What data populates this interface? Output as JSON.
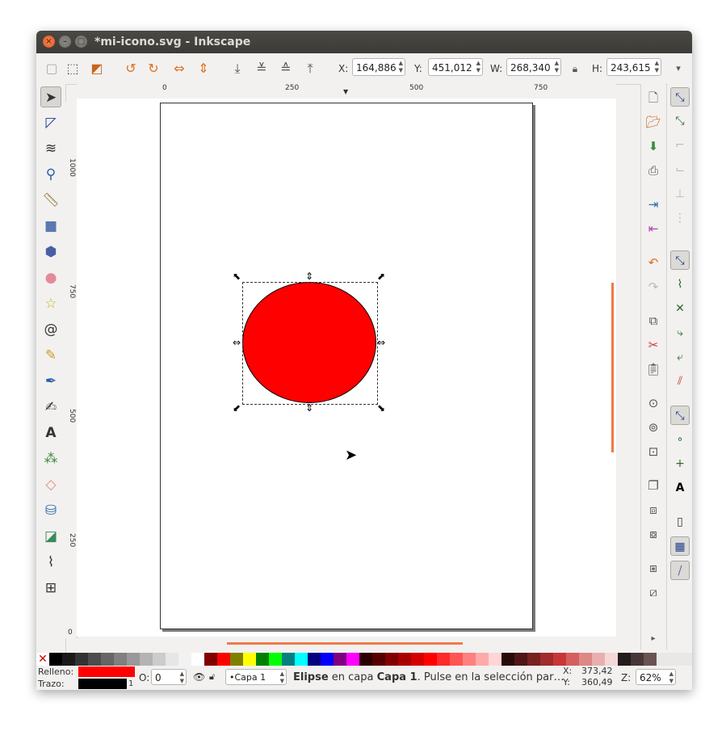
{
  "window": {
    "title": "*mi-icono.svg - Inkscape"
  },
  "toolbar": {
    "x_label": "X:",
    "x_value": "164,886",
    "y_label": "Y:",
    "y_value": "451,012",
    "w_label": "W:",
    "w_value": "268,340",
    "h_label": "H:",
    "h_value": "243,615"
  },
  "ruler": {
    "h_ticks": [
      "0",
      "250",
      "500",
      "750"
    ],
    "v_ticks": [
      "1000",
      "750",
      "500",
      "250",
      "0"
    ]
  },
  "tools": [
    "selector-tool",
    "node-tool",
    "tweak-tool",
    "zoom-tool",
    "measure-tool",
    "rectangle-tool",
    "3dbox-tool",
    "ellipse-tool",
    "star-tool",
    "spiral-tool",
    "pencil-tool",
    "pen-tool",
    "calligraphy-tool",
    "text-tool",
    "spray-tool",
    "eraser-tool",
    "bucket-tool",
    "gradient-tool",
    "dropper-tool",
    "connector-tool"
  ],
  "status": {
    "fill_label": "Relleno:",
    "stroke_label": "Trazo:",
    "stroke_width": "1",
    "opacity_label": "O:",
    "opacity_value": "0",
    "layer": "•Capa 1",
    "message_bold": "Elipse",
    "message_mid": " en capa ",
    "message_layer": "Capa 1",
    "message_rest": ". Pulse en la selección par…",
    "x_coord_label": "X:",
    "x_coord": "373,42",
    "y_coord_label": "Y:",
    "y_coord": "360,49",
    "zoom_label": "Z:",
    "zoom_value": "62%"
  },
  "colors": {
    "fill": "#ff0000",
    "stroke": "#000000",
    "accent_scroll": "#ef7a4a"
  },
  "palette": [
    "#000000",
    "#1a1a1a",
    "#333333",
    "#4d4d4d",
    "#666666",
    "#808080",
    "#999999",
    "#b3b3b3",
    "#cccccc",
    "#e6e6e6",
    "#f2f2f2",
    "#ffffff",
    "#800000",
    "#ff0000",
    "#808000",
    "#ffff00",
    "#008000",
    "#00ff00",
    "#008080",
    "#00ffff",
    "#000080",
    "#0000ff",
    "#800080",
    "#ff00ff",
    "#2b0000",
    "#550000",
    "#800000",
    "#aa0000",
    "#d40000",
    "#ff0000",
    "#ff2a2a",
    "#ff5555",
    "#ff8080",
    "#ffaaaa",
    "#ffd5d5",
    "#280b0b",
    "#501616",
    "#782121",
    "#a02c2c",
    "#c83737",
    "#d35f5f",
    "#de8787",
    "#e9afaf",
    "#f4d7d7",
    "#241c1c",
    "#483737",
    "#6c5353"
  ]
}
